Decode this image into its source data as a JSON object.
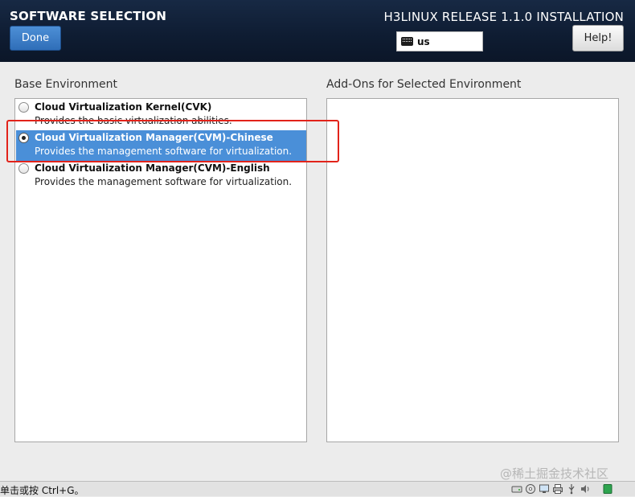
{
  "header": {
    "spoke_title": "SOFTWARE SELECTION",
    "done_label": "Done",
    "product_title": "H3LINUX RELEASE 1.1.0 INSTALLATION",
    "keyboard_layout": "us",
    "help_label": "Help!"
  },
  "base_environment": {
    "label": "Base Environment",
    "items": [
      {
        "name": "Cloud Virtualization Kernel(CVK)",
        "description": "Provides the basic virtualization abilities.",
        "selected": false
      },
      {
        "name": "Cloud Virtualization Manager(CVM)-Chinese",
        "description": "Provides the management software for virtualization.",
        "selected": true
      },
      {
        "name": "Cloud Virtualization Manager(CVM)-English",
        "description": "Provides the management software for virtualization.",
        "selected": false
      }
    ]
  },
  "addons": {
    "label": "Add-Ons for Selected Environment",
    "items": []
  },
  "statusbar": {
    "hint": "单击或按 Ctrl+G。",
    "tray_icons": [
      "disk-icon",
      "cdrom-icon",
      "network-icon",
      "printer-icon",
      "usb-icon",
      "sound-icon",
      "display-icon"
    ]
  },
  "watermark": "@稀土掘金技术社区",
  "colors": {
    "header_bg": "#0f1d33",
    "selection": "#4a8fd8",
    "done_button": "#3a7cc6",
    "annotation_box": "#e2231a"
  }
}
